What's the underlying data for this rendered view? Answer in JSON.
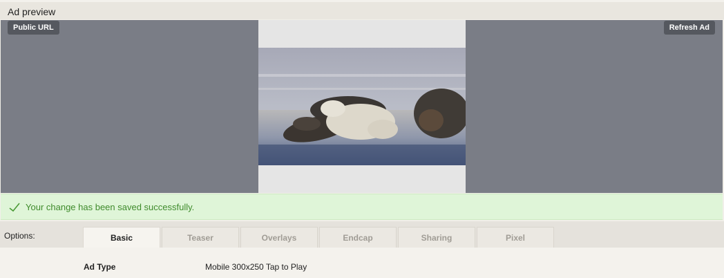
{
  "header": {
    "title": "Ad preview"
  },
  "preview": {
    "public_url_label": "Public URL",
    "refresh_label": "Refresh Ad"
  },
  "status": {
    "message": "Your change has been saved successfully.",
    "color": "#3f8b2c",
    "icon": "checkmark-icon"
  },
  "options": {
    "label": "Options:",
    "tabs": [
      {
        "label": "Basic",
        "active": true
      },
      {
        "label": "Teaser"
      },
      {
        "label": "Overlays"
      },
      {
        "label": "Endcap"
      },
      {
        "label": "Sharing"
      },
      {
        "label": "Pixel"
      }
    ]
  },
  "basic": {
    "ad_type_label": "Ad Type",
    "ad_type_value": "Mobile 300x250 Tap to Play"
  }
}
